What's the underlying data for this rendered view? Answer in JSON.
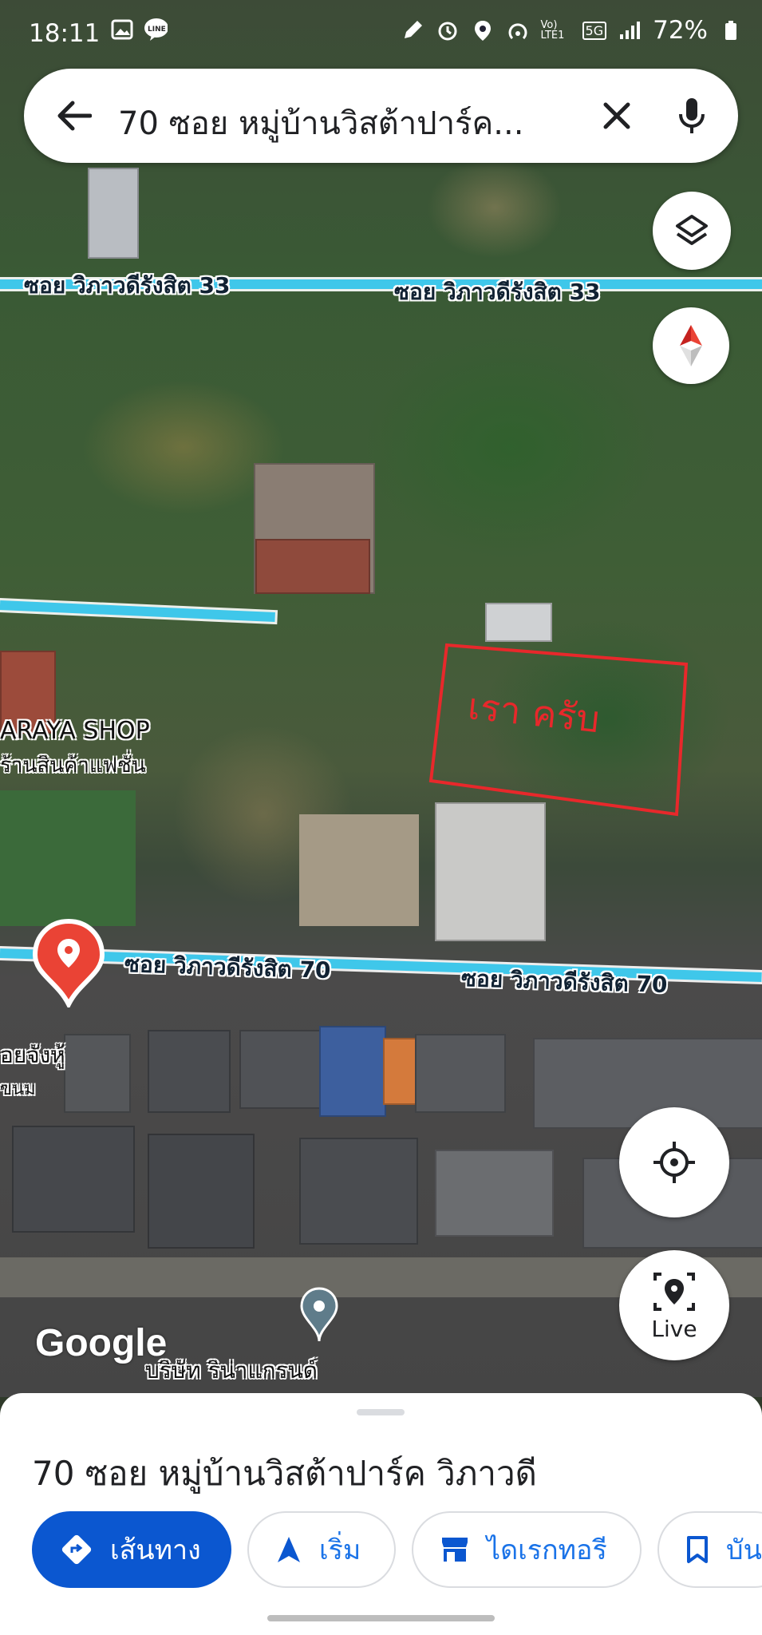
{
  "status_bar": {
    "time": "18:11",
    "network_label": "Vo) LTE1",
    "network_type": "5G",
    "battery": "72%"
  },
  "search": {
    "query": "70 ซอย หมู่บ้านวิสต้าปาร์ค...",
    "back_icon": "arrow-back-icon",
    "clear_icon": "close-icon",
    "voice_icon": "mic-icon"
  },
  "map": {
    "road_labels": [
      "ซอย วิภาวดีรังสิต 33",
      "ซอย วิภาวดีรังสิต 33",
      "ซอย วิภาวดีรังสิต 70",
      "ซอย วิภาวดีรังสิต 70"
    ],
    "places": [
      "ARAYA SHOP",
      "ร้านสินค้าแฟชั่น",
      "อยจังหู้",
      "ขนม",
      "บริษัท ริน่าแกรนด์"
    ],
    "annotation_text": "เรา ครับ",
    "google_logo": "Google",
    "road_color": "#3fc7ea",
    "pin_color": "#ea4335",
    "annotation_color": "#e8282b"
  },
  "controls": {
    "layers_icon": "layers-icon",
    "compass_icon": "compass-icon",
    "my_location_icon": "my-location-icon",
    "live_label": "Live"
  },
  "sheet": {
    "title": "70 ซอย หมู่บ้านวิสต้าปาร์ค วิภาวดี",
    "chips": [
      {
        "label": "เส้นทาง",
        "icon": "directions-icon"
      },
      {
        "label": "เริ่ม",
        "icon": "navigation-arrow-icon"
      },
      {
        "label": "ไดเรกทอรี",
        "icon": "store-icon"
      },
      {
        "label": "บัน",
        "icon": "bookmark-icon"
      }
    ]
  }
}
